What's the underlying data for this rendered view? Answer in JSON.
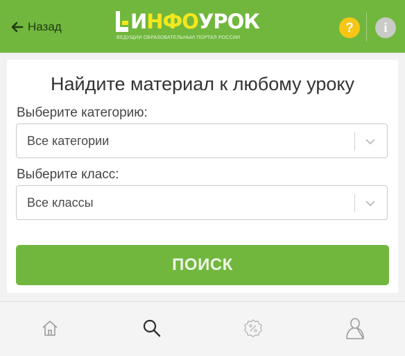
{
  "header": {
    "back_label": "Назад",
    "logo_part_1": "И",
    "logo_part_2": "НФО",
    "logo_part_3": "УРОК",
    "logo_tagline": "ВЕДУЩИЙ ОБРАЗОВАТЕЛЬНЫЙ ПОРТАЛ РОССИИ",
    "help_glyph": "?",
    "info_glyph": "i",
    "accent_color": "#71b73e"
  },
  "search_card": {
    "title": "Найдите материал к любому уроку",
    "category_label": "Выберите категорию:",
    "category_value": "Все категории",
    "class_label": "Выберите класс:",
    "class_value": "Все классы",
    "search_button": "ПОИСК"
  },
  "bottom_nav": {
    "items": [
      {
        "icon": "home-icon"
      },
      {
        "icon": "search-icon"
      },
      {
        "icon": "discount-icon"
      },
      {
        "icon": "profile-icon"
      }
    ]
  }
}
